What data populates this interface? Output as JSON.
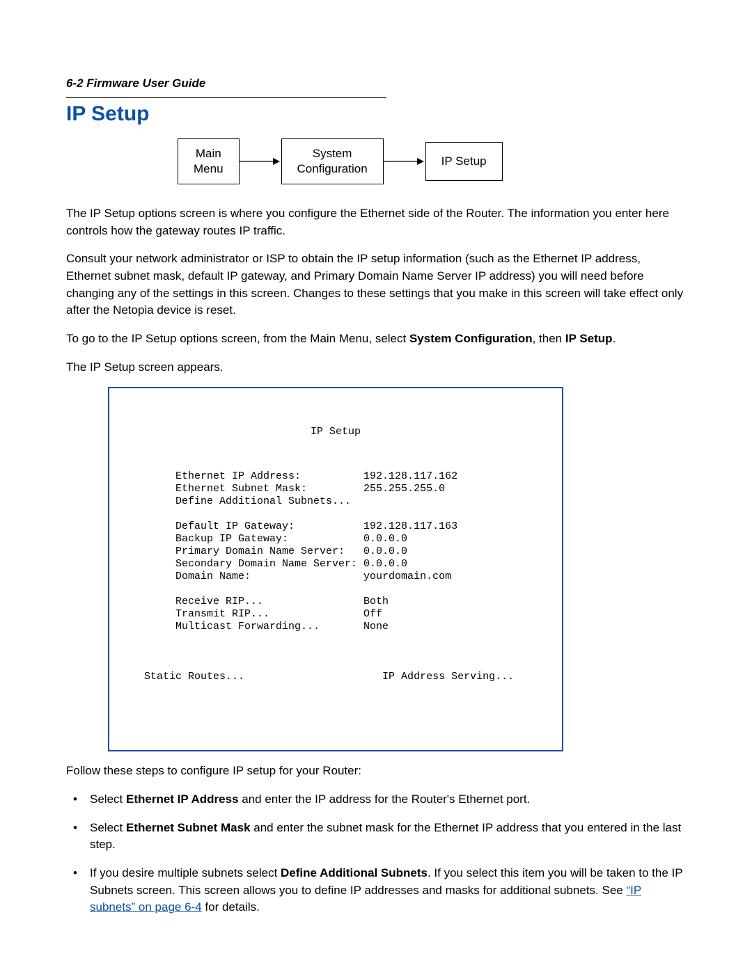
{
  "header": "6-2  Firmware User Guide",
  "title": "IP Setup",
  "nav": {
    "box1_line1": "Main",
    "box1_line2": "Menu",
    "box2_line1": "System",
    "box2_line2": "Configuration",
    "box3": "IP Setup"
  },
  "para1": "The IP Setup options screen is where you configure the Ethernet side of the Router. The information you enter here controls how the gateway routes IP traffic.",
  "para2": "Consult your network administrator or ISP to obtain the IP setup information (such as the Ethernet IP address, Ethernet subnet mask, default IP gateway, and Primary Domain Name Server IP address) you will need before changing any of the settings in this screen. Changes to these settings that you make in this screen will take effect only after the Netopia device is reset.",
  "para3_pre": "To go to the IP Setup options screen, from the Main Menu, select ",
  "para3_b1": "System Configuration",
  "para3_mid": ", then ",
  "para3_b2": "IP Setup",
  "para3_post": ".",
  "para4": "The IP Setup screen appears.",
  "terminal": {
    "title": "IP Setup",
    "rows": [
      {
        "label": "Ethernet IP Address:",
        "value": "192.128.117.162"
      },
      {
        "label": "Ethernet Subnet Mask:",
        "value": "255.255.255.0"
      },
      {
        "label": "Define Additional Subnets...",
        "value": ""
      }
    ],
    "rows2": [
      {
        "label": "Default IP Gateway:",
        "value": "192.128.117.163"
      },
      {
        "label": "Backup IP Gateway:",
        "value": "0.0.0.0"
      },
      {
        "label": "Primary Domain Name Server:",
        "value": "0.0.0.0"
      },
      {
        "label": "Secondary Domain Name Server:",
        "value": "0.0.0.0"
      },
      {
        "label": "Domain Name:",
        "value": "yourdomain.com"
      }
    ],
    "rows3": [
      {
        "label": "Receive RIP...",
        "value": "Both"
      },
      {
        "label": "Transmit RIP...",
        "value": "Off"
      },
      {
        "label": "Multicast Forwarding...",
        "value": "None"
      }
    ],
    "footer_left": "Static Routes...",
    "footer_right": "IP Address Serving..."
  },
  "para5": "Follow these steps to configure IP setup for your Router:",
  "bullets": {
    "b1_pre": "Select ",
    "b1_bold": "Ethernet IP Address",
    "b1_post": " and enter the IP address for the Router's Ethernet port.",
    "b2_pre": "Select ",
    "b2_bold": "Ethernet Subnet Mask",
    "b2_post": " and enter the subnet mask for the Ethernet IP address that you entered in the last step.",
    "b3_pre": "If you desire multiple subnets select ",
    "b3_bold": "Define Additional Subnets",
    "b3_mid": ". If you select this item you will be taken to the IP Subnets screen. This screen allows you to define IP addresses and masks for additional subnets. See ",
    "b3_link": "“IP subnets” on page 6-4",
    "b3_post": " for details."
  }
}
